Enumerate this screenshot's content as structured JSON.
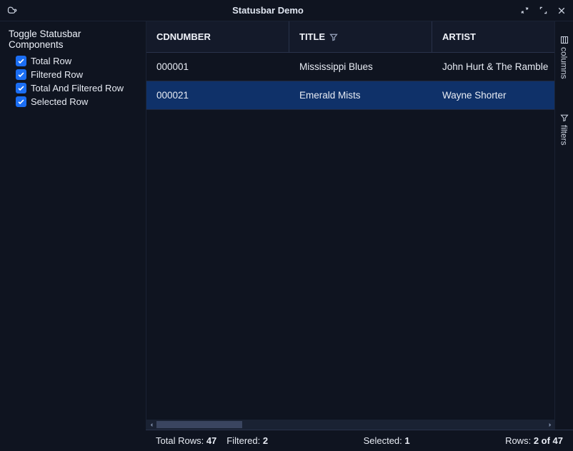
{
  "window": {
    "title": "Statusbar Demo"
  },
  "sidebar": {
    "heading": "Toggle Statusbar Components",
    "items": [
      {
        "label": "Total Row",
        "checked": true
      },
      {
        "label": "Filtered Row",
        "checked": true
      },
      {
        "label": "Total And Filtered Row",
        "checked": true
      },
      {
        "label": "Selected Row",
        "checked": true
      }
    ]
  },
  "table": {
    "columns": [
      {
        "key": "cdnumber",
        "label": "CDNUMBER",
        "filtered": false
      },
      {
        "key": "title",
        "label": "TITLE",
        "filtered": true
      },
      {
        "key": "artist",
        "label": "ARTIST",
        "filtered": false
      }
    ],
    "rows": [
      {
        "cdnumber": "000001",
        "title": "Mississippi Blues",
        "artist": "John Hurt & The Ramble",
        "selected": false
      },
      {
        "cdnumber": "000021",
        "title": "Emerald Mists",
        "artist": "Wayne Shorter",
        "selected": true
      }
    ]
  },
  "rightstrip": {
    "tabs": [
      {
        "name": "columns",
        "label": "columns",
        "icon": "columns"
      },
      {
        "name": "filters",
        "label": "filters",
        "icon": "funnel"
      }
    ]
  },
  "statusbar": {
    "total_label": "Total Rows:",
    "total_value": "47",
    "filtered_label": "Filtered:",
    "filtered_value": "2",
    "selected_label": "Selected:",
    "selected_value": "1",
    "rows_label": "Rows:",
    "rows_value": "2 of 47"
  }
}
